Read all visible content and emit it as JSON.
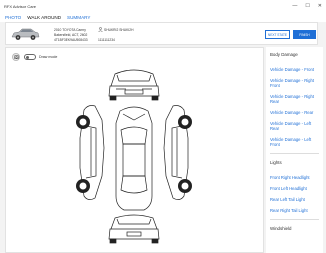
{
  "window": {
    "title": "RFX Advisor Care",
    "controls": [
      "—",
      "☐",
      "✕"
    ]
  },
  "tabs": [
    {
      "label": "PHOTO",
      "active": false
    },
    {
      "label": "WALK AROUND",
      "active": true
    },
    {
      "label": "SUMMARY",
      "active": false
    }
  ],
  "vehicle": {
    "name": "2010 TOYOTA Camry",
    "location": "Bakersfield, ACT, 2602",
    "vin": "4T1BF3EK9AU508433",
    "owner": "SHUKRI2 SHUKI2H",
    "phone": "1111111234"
  },
  "actions": {
    "next": "NEXT STATE",
    "finish": "FINISH"
  },
  "canvas": {
    "draw_mode_label": "Draw mode"
  },
  "side_panel": {
    "body_heading": "Body Damage",
    "body_links": [
      "Vehicle Damage - Front",
      "Vehicle Damage - Right Front",
      "Vehicle Damage - Right Rear",
      "Vehicle Damage - Rear",
      "Vehicle Damage - Left Rear",
      "Vehicle Damage - Left Front"
    ],
    "lights_heading": "Lights",
    "lights_links": [
      "Front Right Headlight",
      "Front Left Headlight",
      "Rear Left Tail Light",
      "Rear Right Tail Light"
    ],
    "windshield_heading": "Windshield"
  },
  "colors": {
    "accent": "#1f6fd6"
  }
}
